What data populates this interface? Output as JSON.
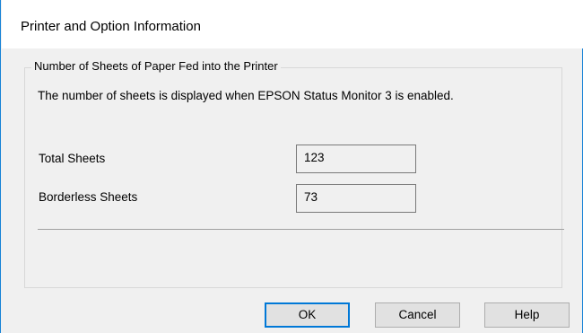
{
  "dialog": {
    "title": "Printer and Option Information"
  },
  "group": {
    "legend": "Number of Sheets of Paper Fed into the Printer",
    "description": "The number of sheets is displayed when EPSON Status Monitor 3 is enabled.",
    "fields": [
      {
        "label": "Total Sheets",
        "value": "123"
      },
      {
        "label": "Borderless Sheets",
        "value": "73"
      }
    ]
  },
  "buttons": {
    "ok": "OK",
    "cancel": "Cancel",
    "help": "Help"
  },
  "colors": {
    "window_border": "#1883d7",
    "default_button_border": "#0078d7",
    "dialog_background": "#f0f0f0"
  }
}
